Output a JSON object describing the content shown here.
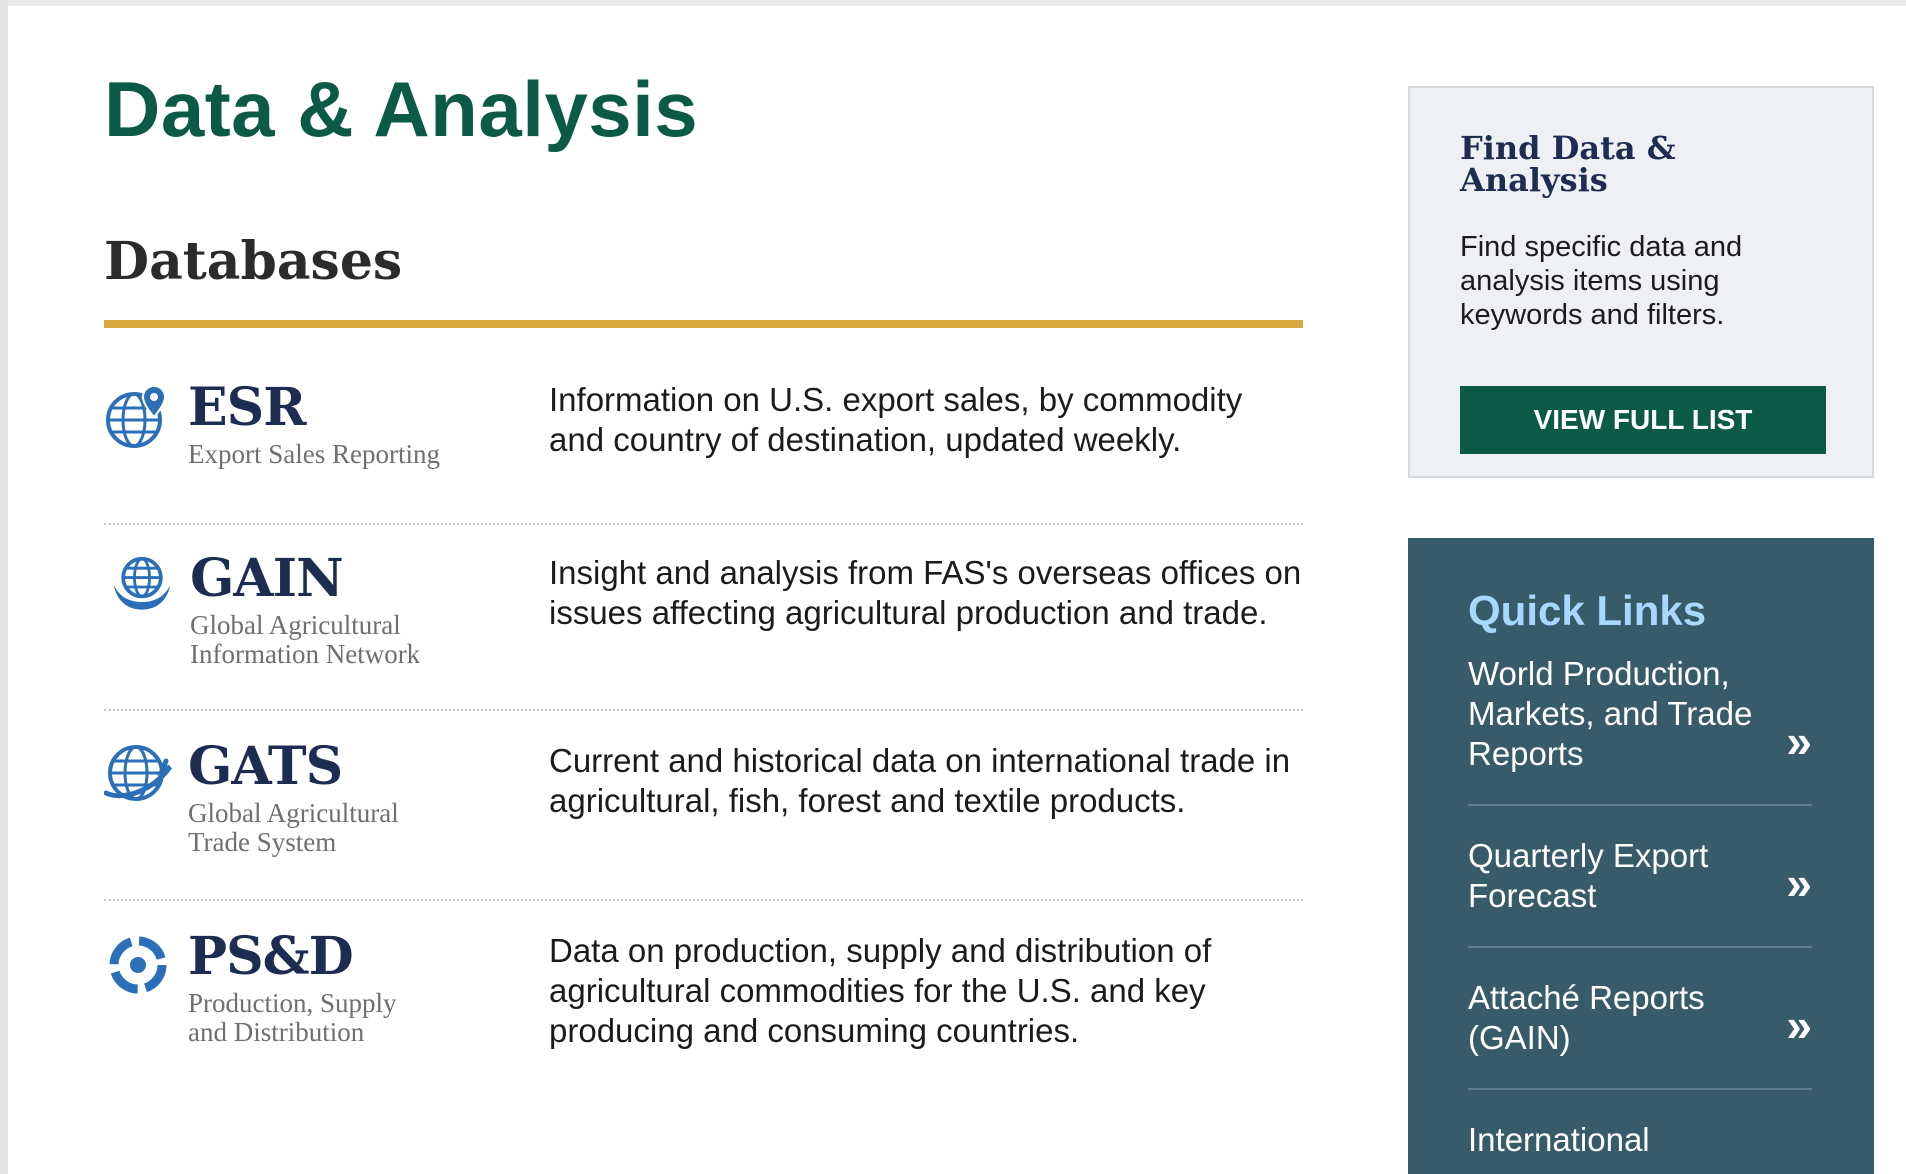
{
  "main": {
    "title": "Data & Analysis",
    "section_title": "Databases",
    "databases": [
      {
        "abbr": "ESR",
        "full_name_lines": [
          "Export Sales Reporting"
        ],
        "icon": "globe-pin-icon",
        "description": "Information on U.S. export sales, by commodity and country of destination, updated weekly."
      },
      {
        "abbr": "GAIN",
        "full_name_lines": [
          "Global Agricultural",
          "Information Network"
        ],
        "icon": "globe-hands-icon",
        "description": "Insight and analysis from FAS's overseas offices on issues affecting agricultural production and trade."
      },
      {
        "abbr": "GATS",
        "full_name_lines": [
          "Global Agricultural",
          "Trade System"
        ],
        "icon": "globe-orbit-icon",
        "description": "Current and historical data on international trade in agricultural, fish, forest and textile products."
      },
      {
        "abbr": "PS&D",
        "full_name_lines": [
          "Production, Supply",
          "and Distribution"
        ],
        "icon": "cycle-arrows-icon",
        "description": "Data on production, supply and distribution of agricultural commodities for the U.S. and key producing and consuming countries."
      }
    ]
  },
  "sidebar": {
    "find": {
      "title": "Find Data & Analysis",
      "text": "Find specific data and analysis items using keywords and filters.",
      "button_label": "VIEW FULL LIST"
    },
    "quick_links": {
      "title": "Quick Links",
      "items": [
        {
          "label": "World Production, Markets, and Trade Reports",
          "arrow": "»"
        },
        {
          "label": "Quarterly Export Forecast",
          "arrow": "»"
        },
        {
          "label": "Attaché Reports (GAIN)",
          "arrow": "»"
        },
        {
          "label": "International",
          "arrow": ""
        }
      ]
    }
  },
  "colors": {
    "title_green": "#0b5a45",
    "gold_rule": "#d8aa3e",
    "navy": "#1d2d52",
    "quick_links_bg": "#385b6a",
    "quick_links_title": "#a8d8ff",
    "icon_blue": "#2a6fb8"
  }
}
